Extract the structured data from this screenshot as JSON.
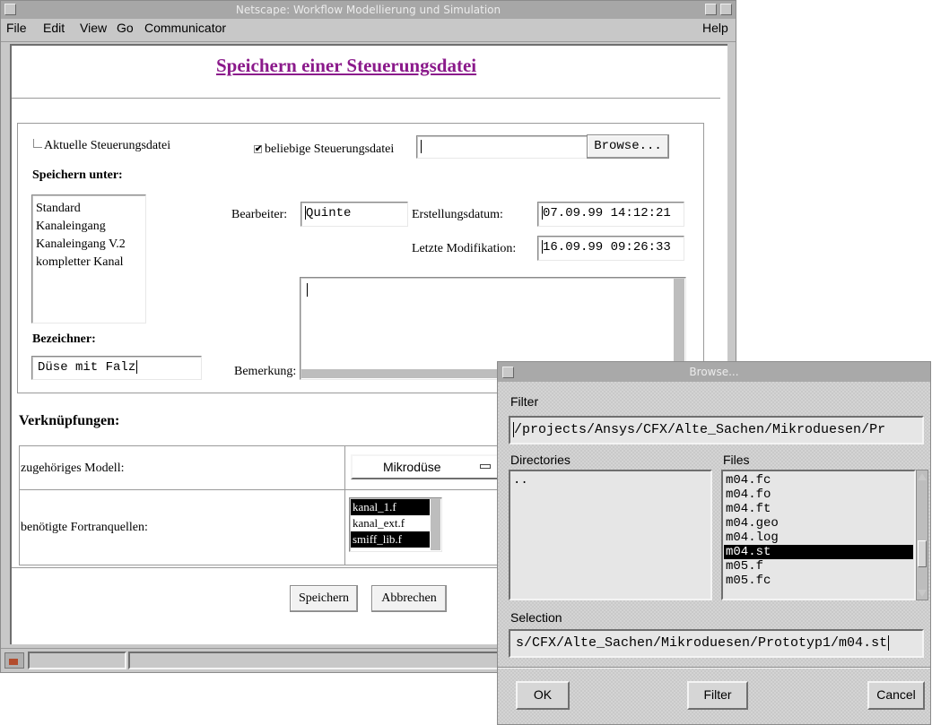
{
  "window": {
    "title": "Netscape: Workflow Modellierung und Simulation",
    "menu": [
      "File",
      "Edit",
      "View",
      "Go",
      "Communicator"
    ],
    "help": "Help"
  },
  "page": {
    "heading": "Speichern einer Steuerungsdatei",
    "radio_current": "Aktuelle Steuerungsdatei",
    "radio_any": "beliebige Steuerungsdatei",
    "browse_button": "Browse...",
    "save_under_label": "Speichern unter:",
    "save_under_items": [
      "Standard",
      "Kanaleingang",
      "Kanaleingang V.2",
      "kompletter Kanal"
    ],
    "editor_label": "Bearbeiter:",
    "editor_value": "Quinte",
    "created_label": "Erstellungsdatum:",
    "created_value": "07.09.99 14:12:21",
    "modified_label": "Letzte Modifikation:",
    "modified_value": "16.09.99 09:26:33",
    "identifier_label": "Bezeichner:",
    "identifier_value": "Düse mit Falz",
    "remark_label": "Bemerkung:",
    "links_heading": "Verknüpfungen:",
    "model_label": "zugehöriges Modell:",
    "model_value": "Mikrodüse",
    "fortran_label": "benötigte Fortranquellen:",
    "fortran_items": [
      {
        "name": "kanal_1.f",
        "selected": true
      },
      {
        "name": "kanal_ext.f",
        "selected": false
      },
      {
        "name": "smiff_lib.f",
        "selected": true
      }
    ],
    "save_button": "Speichern",
    "cancel_button": "Abbrechen"
  },
  "dialog": {
    "title": "Browse...",
    "filter_label": "Filter",
    "filter_value": "/projects/Ansys/CFX/Alte_Sachen/Mikroduesen/Pr",
    "directories_label": "Directories",
    "directories": [
      ".."
    ],
    "files_label": "Files",
    "files": [
      {
        "name": "m04.fc",
        "selected": false
      },
      {
        "name": "m04.fo",
        "selected": false
      },
      {
        "name": "m04.ft",
        "selected": false
      },
      {
        "name": "m04.geo",
        "selected": false
      },
      {
        "name": "m04.log",
        "selected": false
      },
      {
        "name": "m04.st",
        "selected": true
      },
      {
        "name": "m05.f",
        "selected": false
      },
      {
        "name": "m05.fc",
        "selected": false
      }
    ],
    "selection_label": "Selection",
    "selection_value": "s/CFX/Alte_Sachen/Mikroduesen/Prototyp1/m04.st",
    "ok_button": "OK",
    "filter_button": "Filter",
    "cancel_button": "Cancel"
  }
}
